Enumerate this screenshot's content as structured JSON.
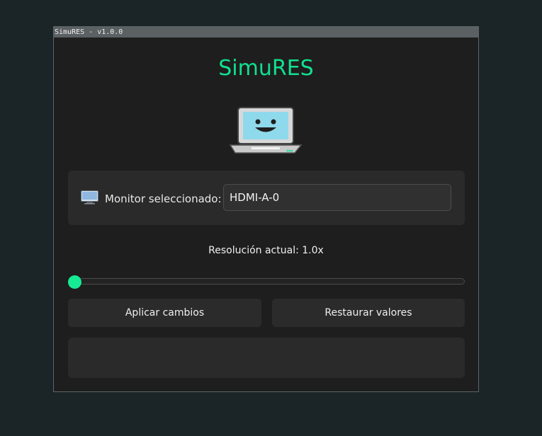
{
  "window": {
    "title": "SimuRES - v1.0.0"
  },
  "app": {
    "title": "SimuRES"
  },
  "monitor": {
    "label": "Monitor seleccionado:",
    "value": "HDMI-A-0"
  },
  "resolution": {
    "label": "Resolución actual: 1.0x",
    "slider_fraction": 0
  },
  "buttons": {
    "apply_label": "Aplicar cambios",
    "restore_label": "Restaurar valores"
  },
  "status": {
    "message": ""
  },
  "icons": {
    "mascot": "laptop-smiling-icon",
    "monitor": "monitor-icon"
  },
  "colors": {
    "background": "#1b2528",
    "window": "#1e1e1e",
    "accent": "#10e08f",
    "panel": "#2a2a2a",
    "text": "#efefef"
  }
}
